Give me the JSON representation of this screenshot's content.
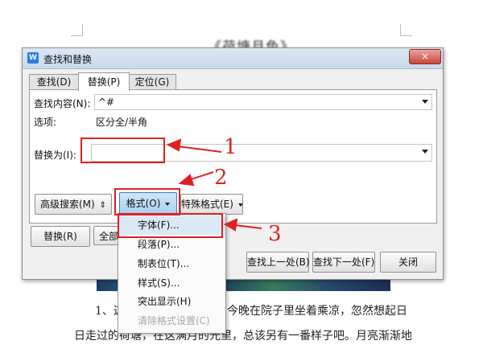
{
  "document": {
    "title": "《荷塘月色》",
    "line1_left": "1、这",
    "line1_right": "今晚在院子里坐着乘凉，忽然想起日",
    "line2": "日走过的荷塘，在这满月的光里，总该另有一番样子吧。月亮渐渐地"
  },
  "dialog": {
    "title": "查找和替换",
    "close_label": "×",
    "tabs": [
      {
        "label": "查找(D)",
        "active": false
      },
      {
        "label": "替换(P)",
        "active": true
      },
      {
        "label": "定位(G)",
        "active": false
      }
    ],
    "find_label": "查找内容(N):",
    "find_value": "^#",
    "options_label": "选项:",
    "options_value": "区分全/半角",
    "replace_label": "替换为(I):",
    "replace_value": "",
    "advanced_search_label": "高级搜索(M)",
    "format_label": "格式(O)",
    "special_format_label": "特殊格式(E)",
    "replace_button": "替换(R)",
    "replace_all_button": "全部",
    "find_prev_button": "查找上一处(B)",
    "find_next_button": "查找下一处(F)",
    "close_button": "关闭"
  },
  "format_menu": {
    "items": [
      {
        "label": "字体(F)...",
        "highlighted": true,
        "disabled": false
      },
      {
        "label": "段落(P)...",
        "highlighted": false,
        "disabled": false
      },
      {
        "label": "制表位(T)...",
        "highlighted": false,
        "disabled": false
      },
      {
        "label": "样式(S)...",
        "highlighted": false,
        "disabled": false
      },
      {
        "label": "突出显示(H)",
        "highlighted": false,
        "disabled": false
      },
      {
        "label": "清除格式设置(C)",
        "highlighted": false,
        "disabled": true
      }
    ]
  },
  "annotations": {
    "step1": "1",
    "step2": "2",
    "step3": "3",
    "color": "#e02020"
  }
}
